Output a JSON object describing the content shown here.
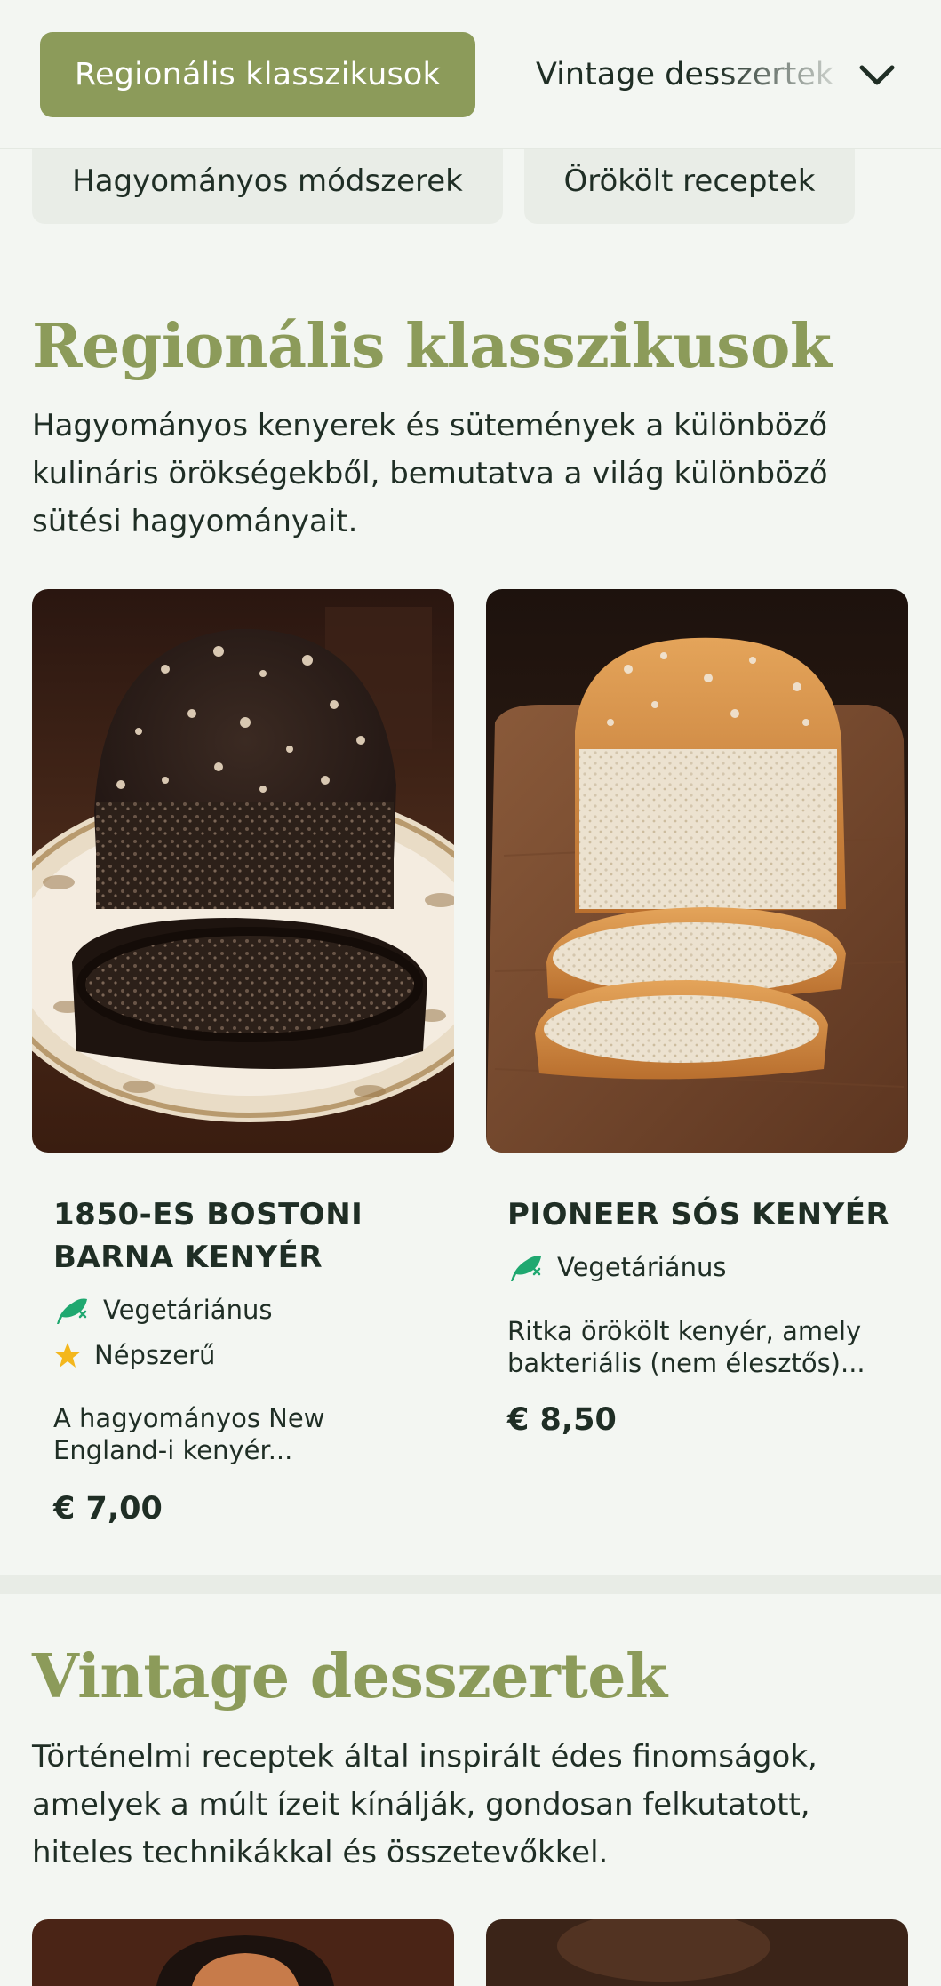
{
  "nav": {
    "active_tab": "Regionális klasszikusok",
    "next_tab": "Vintage desszertek",
    "chips": [
      "Hagyományos módszerek",
      "Örökölt receptek"
    ]
  },
  "sections": [
    {
      "title": "Regionális klasszikusok",
      "description": "Hagyományos kenyerek és sütemények a különböző kulináris örökségekből, bemutatva a világ különböző sütési hagyományait.",
      "products": [
        {
          "name": "1850-ES BOSTONI BARNA KENYÉR",
          "tags": [
            "Vegetáriánus",
            "Népszerű"
          ],
          "description": "A hagyományos New England-i kenyér...",
          "price": "€ 7,00"
        },
        {
          "name": "PIONEER SÓS KENYÉR",
          "tags": [
            "Vegetáriánus"
          ],
          "description": "Ritka örökölt kenyér, amely bakteriális (nem élesztős)...",
          "price": "€ 8,50"
        }
      ]
    },
    {
      "title": "Vintage desszertek",
      "description": "Történelmi receptek által inspirált édes finomságok, amelyek a múlt ízeit kínálják, gondosan felkutatott, hiteles technikákkal és összetevőkkel."
    }
  ],
  "icons": {
    "vegetarian": "leaf-icon",
    "popular": "star-icon",
    "expand": "chevron-down-icon"
  },
  "colors": {
    "accent": "#8c9b5a",
    "background": "#f3f6f2",
    "text": "#1f2e25",
    "vegetarian_icon": "#1fa870",
    "star": "#f3b71d"
  }
}
